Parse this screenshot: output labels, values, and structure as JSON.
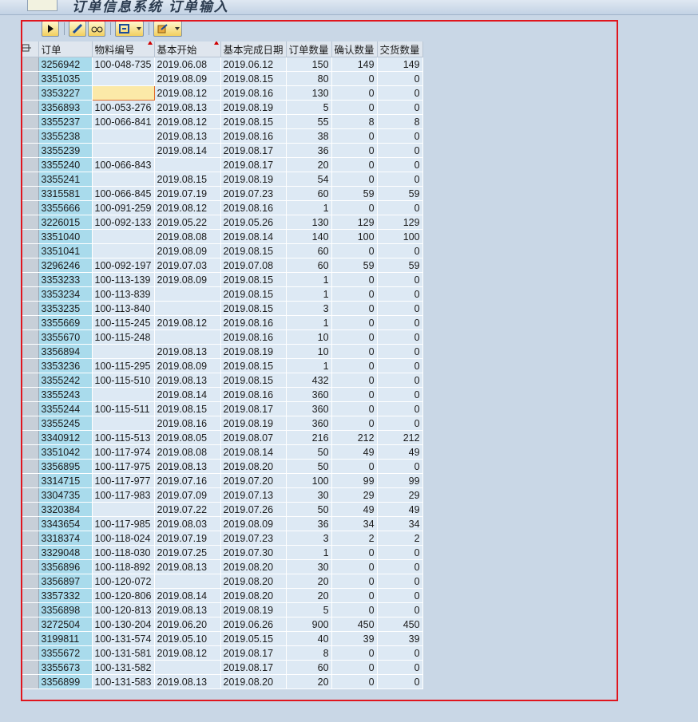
{
  "window": {
    "title": "订单信息系统 订单输入"
  },
  "toolbar": {
    "buttons": [
      {
        "name": "execute-button",
        "icon": "play-icon"
      },
      {
        "name": "edit-button",
        "icon": "pencil-icon"
      },
      {
        "name": "glasses-button",
        "icon": "glasses-icon"
      },
      {
        "name": "layout-button",
        "icon": "layout-icon"
      },
      {
        "name": "export-button",
        "icon": "export-icon"
      }
    ]
  },
  "table": {
    "headers": [
      "订单",
      "物料编号",
      "基本开始",
      "基本完成日期",
      "订单数量",
      "确认数量",
      "交货数量"
    ],
    "sorted_columns": [
      1,
      2
    ],
    "highlighted_cell": {
      "row": 2,
      "col": 1
    },
    "rows": [
      [
        "3256942",
        "100-048-735",
        "2019.06.08",
        "2019.06.12",
        "150",
        "149",
        "149"
      ],
      [
        "3351035",
        "",
        "2019.08.09",
        "2019.08.15",
        "80",
        "0",
        "0"
      ],
      [
        "3353227",
        "",
        "2019.08.12",
        "2019.08.16",
        "130",
        "0",
        "0"
      ],
      [
        "3356893",
        "100-053-276",
        "2019.08.13",
        "2019.08.19",
        "5",
        "0",
        "0"
      ],
      [
        "3355237",
        "100-066-841",
        "2019.08.12",
        "2019.08.15",
        "55",
        "8",
        "8"
      ],
      [
        "3355238",
        "",
        "2019.08.13",
        "2019.08.16",
        "38",
        "0",
        "0"
      ],
      [
        "3355239",
        "",
        "2019.08.14",
        "2019.08.17",
        "36",
        "0",
        "0"
      ],
      [
        "3355240",
        "100-066-843",
        "",
        "2019.08.17",
        "20",
        "0",
        "0"
      ],
      [
        "3355241",
        "",
        "2019.08.15",
        "2019.08.19",
        "54",
        "0",
        "0"
      ],
      [
        "3315581",
        "100-066-845",
        "2019.07.19",
        "2019.07.23",
        "60",
        "59",
        "59"
      ],
      [
        "3355666",
        "100-091-259",
        "2019.08.12",
        "2019.08.16",
        "1",
        "0",
        "0"
      ],
      [
        "3226015",
        "100-092-133",
        "2019.05.22",
        "2019.05.26",
        "130",
        "129",
        "129"
      ],
      [
        "3351040",
        "",
        "2019.08.08",
        "2019.08.14",
        "140",
        "100",
        "100"
      ],
      [
        "3351041",
        "",
        "2019.08.09",
        "2019.08.15",
        "60",
        "0",
        "0"
      ],
      [
        "3296246",
        "100-092-197",
        "2019.07.03",
        "2019.07.08",
        "60",
        "59",
        "59"
      ],
      [
        "3353233",
        "100-113-139",
        "2019.08.09",
        "2019.08.15",
        "1",
        "0",
        "0"
      ],
      [
        "3353234",
        "100-113-839",
        "",
        "2019.08.15",
        "1",
        "0",
        "0"
      ],
      [
        "3353235",
        "100-113-840",
        "",
        "2019.08.15",
        "3",
        "0",
        "0"
      ],
      [
        "3355669",
        "100-115-245",
        "2019.08.12",
        "2019.08.16",
        "1",
        "0",
        "0"
      ],
      [
        "3355670",
        "100-115-248",
        "",
        "2019.08.16",
        "10",
        "0",
        "0"
      ],
      [
        "3356894",
        "",
        "2019.08.13",
        "2019.08.19",
        "10",
        "0",
        "0"
      ],
      [
        "3353236",
        "100-115-295",
        "2019.08.09",
        "2019.08.15",
        "1",
        "0",
        "0"
      ],
      [
        "3355242",
        "100-115-510",
        "2019.08.13",
        "2019.08.15",
        "432",
        "0",
        "0"
      ],
      [
        "3355243",
        "",
        "2019.08.14",
        "2019.08.16",
        "360",
        "0",
        "0"
      ],
      [
        "3355244",
        "100-115-511",
        "2019.08.15",
        "2019.08.17",
        "360",
        "0",
        "0"
      ],
      [
        "3355245",
        "",
        "2019.08.16",
        "2019.08.19",
        "360",
        "0",
        "0"
      ],
      [
        "3340912",
        "100-115-513",
        "2019.08.05",
        "2019.08.07",
        "216",
        "212",
        "212"
      ],
      [
        "3351042",
        "100-117-974",
        "2019.08.08",
        "2019.08.14",
        "50",
        "49",
        "49"
      ],
      [
        "3356895",
        "100-117-975",
        "2019.08.13",
        "2019.08.20",
        "50",
        "0",
        "0"
      ],
      [
        "3314715",
        "100-117-977",
        "2019.07.16",
        "2019.07.20",
        "100",
        "99",
        "99"
      ],
      [
        "3304735",
        "100-117-983",
        "2019.07.09",
        "2019.07.13",
        "30",
        "29",
        "29"
      ],
      [
        "3320384",
        "",
        "2019.07.22",
        "2019.07.26",
        "50",
        "49",
        "49"
      ],
      [
        "3343654",
        "100-117-985",
        "2019.08.03",
        "2019.08.09",
        "36",
        "34",
        "34"
      ],
      [
        "3318374",
        "100-118-024",
        "2019.07.19",
        "2019.07.23",
        "3",
        "2",
        "2"
      ],
      [
        "3329048",
        "100-118-030",
        "2019.07.25",
        "2019.07.30",
        "1",
        "0",
        "0"
      ],
      [
        "3356896",
        "100-118-892",
        "2019.08.13",
        "2019.08.20",
        "30",
        "0",
        "0"
      ],
      [
        "3356897",
        "100-120-072",
        "",
        "2019.08.20",
        "20",
        "0",
        "0"
      ],
      [
        "3357332",
        "100-120-806",
        "2019.08.14",
        "2019.08.20",
        "20",
        "0",
        "0"
      ],
      [
        "3356898",
        "100-120-813",
        "2019.08.13",
        "2019.08.19",
        "5",
        "0",
        "0"
      ],
      [
        "3272504",
        "100-130-204",
        "2019.06.20",
        "2019.06.26",
        "900",
        "450",
        "450"
      ],
      [
        "3199811",
        "100-131-574",
        "2019.05.10",
        "2019.05.15",
        "40",
        "39",
        "39"
      ],
      [
        "3355672",
        "100-131-581",
        "2019.08.12",
        "2019.08.17",
        "8",
        "0",
        "0"
      ],
      [
        "3355673",
        "100-131-582",
        "",
        "2019.08.17",
        "60",
        "0",
        "0"
      ],
      [
        "3356899",
        "100-131-583",
        "2019.08.13",
        "2019.08.20",
        "20",
        "0",
        "0"
      ]
    ]
  },
  "annotation": {
    "color": "#e0151d"
  }
}
